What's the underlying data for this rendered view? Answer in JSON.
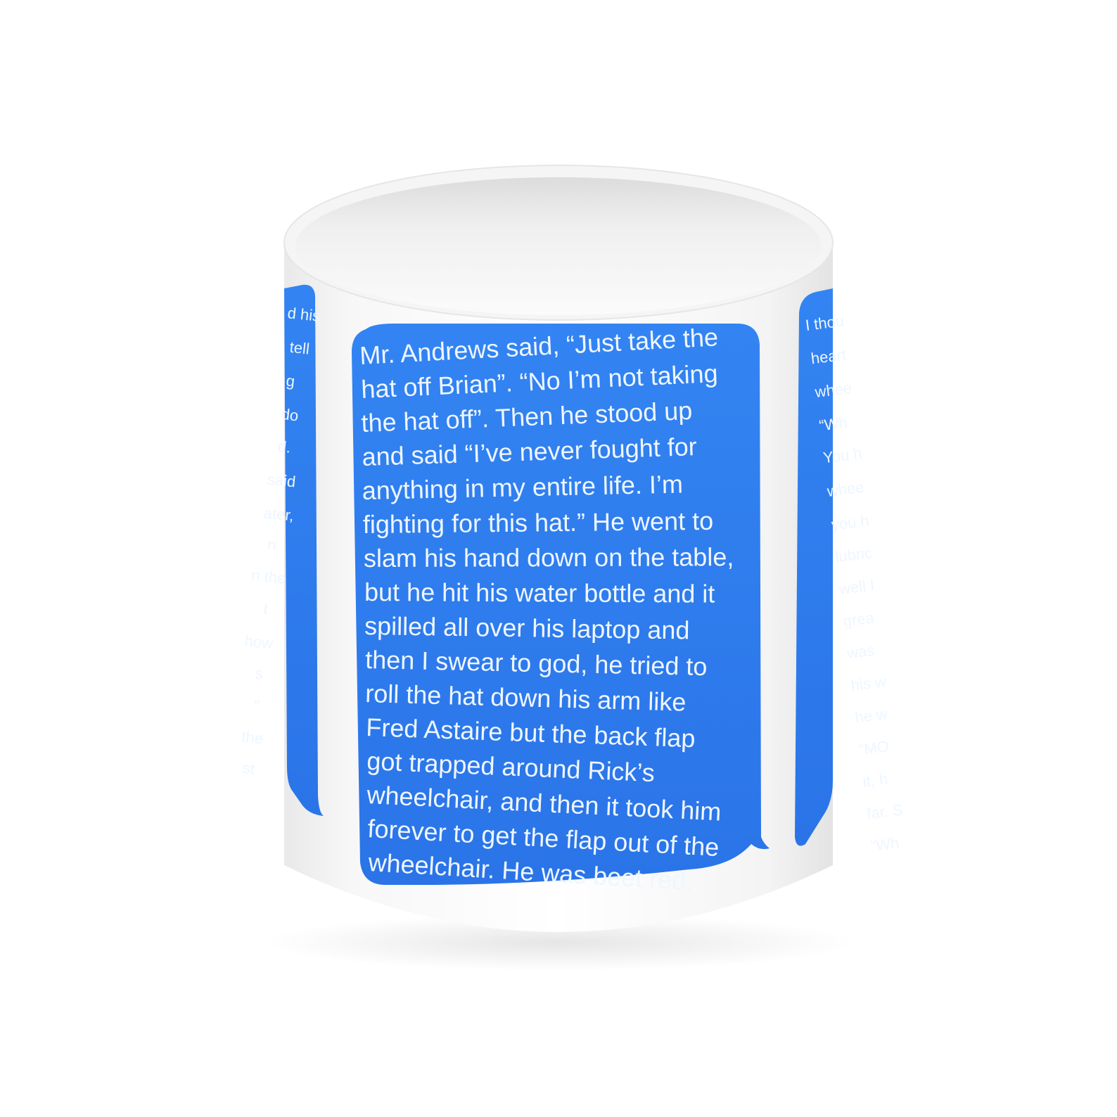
{
  "colors": {
    "bubble_blue": "#2f7ff0",
    "bubble_blue_dark": "#2a72e6",
    "text": "#eef6ff",
    "mug_white": "#f6f6f6",
    "background": "#ffffff"
  },
  "front_message": {
    "lines": [
      "Mr. Andrews said, “Just take the",
      "hat off Brian”. “No I’m not taking",
      "the hat off”. Then he stood up",
      "and said “I’ve never fought for",
      "anything in my entire life. I’m",
      "fighting for this hat.” He went to",
      "slam his hand down on the table,",
      "but he hit his water bottle and it",
      "spilled all over his laptop and",
      "then I swear to god, he tried to",
      "roll the hat down his arm like",
      "Fred Astaire but the back flap",
      "got trapped around Rick’s",
      "wheelchair, and then it took him",
      "forever to get the flap out of the",
      "wheelchair. He was beet red."
    ]
  },
  "left_message": {
    "fragments": [
      "d his",
      "tell",
      "g",
      "do",
      "d.",
      "said",
      "ater,",
      "n",
      "n the",
      "t",
      "how",
      "s",
      "”",
      "the",
      "st"
    ]
  },
  "right_message": {
    "fragments": [
      "I thou",
      "heart",
      "whee",
      "“Wh",
      "You h",
      "whee",
      "you h",
      "lubric",
      "well I",
      "grea",
      "was",
      "his w",
      "he w",
      "“MO",
      "it, h",
      "far. S",
      "“Wh"
    ]
  }
}
